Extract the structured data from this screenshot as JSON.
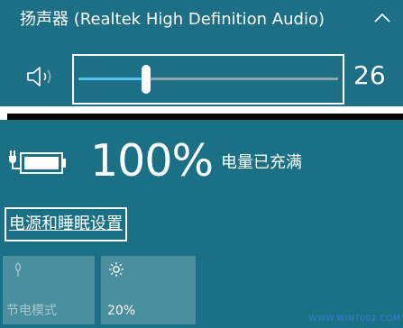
{
  "volume": {
    "device_name": "扬声器 (Realtek High Definition Audio)",
    "level": 26,
    "level_text": "26",
    "max": 100,
    "icons": {
      "speaker": "speaker-volume-icon",
      "collapse": "chevron-up-icon"
    },
    "colors": {
      "panel": "#1c6f84",
      "fill": "#56c3ee",
      "track": "#8fa5ad"
    }
  },
  "battery": {
    "percent_text": "100%",
    "status": "电量已充满",
    "power_settings_link": "电源和睡眠设置",
    "icons": {
      "battery": "battery-charging-icon"
    },
    "colors": {
      "panel": "#1a7186",
      "tile": "#4a8f9e"
    }
  },
  "quick_actions": [
    {
      "label": "节电模式",
      "icon": "leaf-icon"
    },
    {
      "label": "20%",
      "icon": "brightness-sun-icon"
    }
  ],
  "watermark": "WWW.WIN7002.COM"
}
